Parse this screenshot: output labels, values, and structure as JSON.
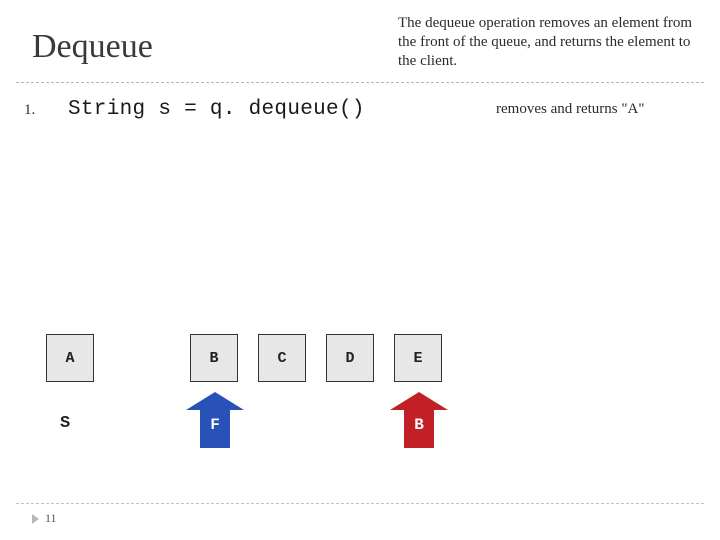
{
  "title": "Dequeue",
  "description": "The dequeue operation removes an element from the front of the queue, and returns the element to the client.",
  "step": {
    "num": "1.",
    "code": "String s = q. dequeue()"
  },
  "note": "removes and returns \"A\"",
  "removed": "A",
  "queue": {
    "b": "B",
    "c": "C",
    "d": "D",
    "e": "E"
  },
  "sLabel": "S",
  "pointers": {
    "front": "F",
    "back": "B"
  },
  "pageNumber": "11",
  "colors": {
    "frontArrow": "#2852b8",
    "backArrow": "#c12026",
    "cellBg": "#e7e7e7"
  }
}
